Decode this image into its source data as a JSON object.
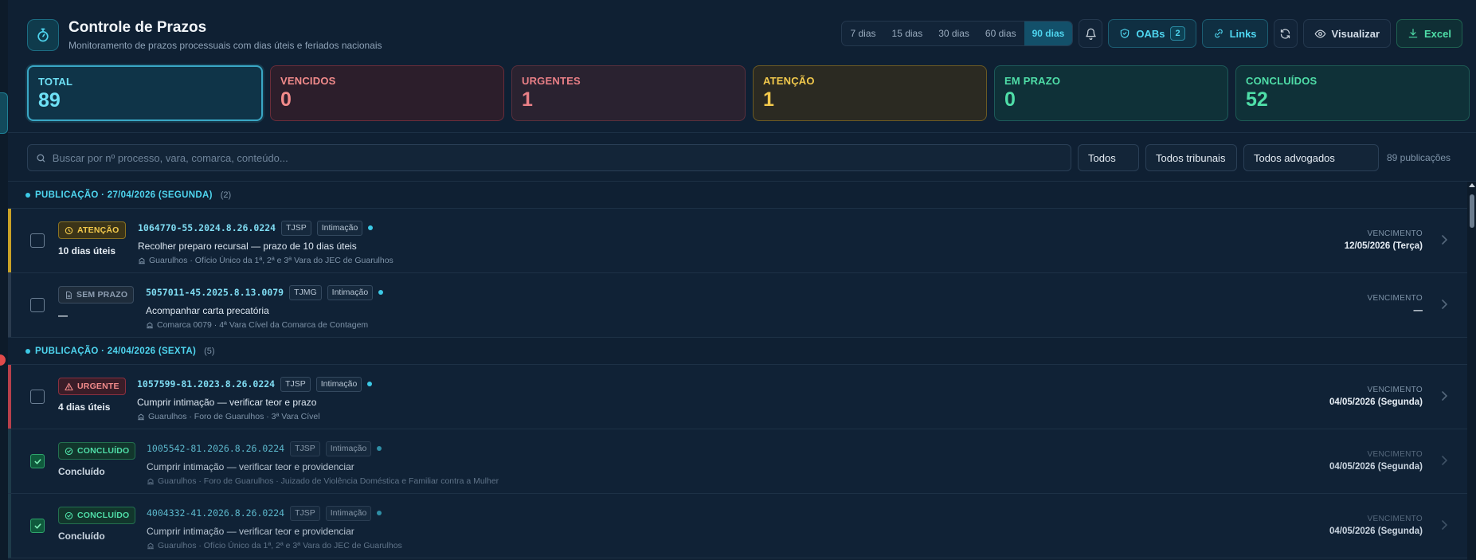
{
  "header": {
    "title": "Controle de Prazos",
    "subtitle": "Monitoramento de prazos processuais com dias úteis e feriados nacionais"
  },
  "toolbar": {
    "periods": [
      "7 dias",
      "15 dias",
      "30 dias",
      "60 dias",
      "90 dias"
    ],
    "active_period": "90 dias",
    "oabs_label": "OABs",
    "oabs_count": "2",
    "links_label": "Links",
    "visualizar_label": "Visualizar",
    "excel_label": "Excel"
  },
  "stats": [
    {
      "label": "TOTAL",
      "value": "89"
    },
    {
      "label": "VENCIDOS",
      "value": "0"
    },
    {
      "label": "URGENTES",
      "value": "1"
    },
    {
      "label": "ATENÇÃO",
      "value": "1"
    },
    {
      "label": "EM PRAZO",
      "value": "0"
    },
    {
      "label": "CONCLUÍDOS",
      "value": "52"
    }
  ],
  "filters": {
    "search_placeholder": "Buscar por nº processo, vara, comarca, conteúdo...",
    "status_select": "Todos",
    "tribunal_select": "Todos tribunais",
    "advogado_select": "Todos advogados",
    "count_text": "89 publicações"
  },
  "groups": [
    {
      "title": "PUBLICAÇÃO · 27/04/2026 (SEGUNDA)",
      "count": "(2)",
      "rows": [
        {
          "status": "ATENÇÃO",
          "days": "10 dias úteis",
          "process": "1064770-55.2024.8.26.0224",
          "tribunal": "TJSP",
          "type": "Intimação",
          "description": "Recolher preparo recursal — prazo de 10 dias úteis",
          "location": "Guarulhos · Ofício Único da 1ª, 2ª e 3ª Vara do JEC de Guarulhos",
          "venc_label": "VENCIMENTO",
          "venc_date": "12/05/2026 (Terça)"
        },
        {
          "status": "SEM PRAZO",
          "days": "—",
          "process": "5057011-45.2025.8.13.0079",
          "tribunal": "TJMG",
          "type": "Intimação",
          "description": "Acompanhar carta precatória",
          "location": "Comarca 0079 · 4ª Vara Cível da Comarca de Contagem",
          "venc_label": "VENCIMENTO",
          "venc_date": "—"
        }
      ]
    },
    {
      "title": "PUBLICAÇÃO · 24/04/2026 (SEXTA)",
      "count": "(5)",
      "rows": [
        {
          "status": "URGENTE",
          "days": "4 dias úteis",
          "process": "1057599-81.2023.8.26.0224",
          "tribunal": "TJSP",
          "type": "Intimação",
          "description": "Cumprir intimação — verificar teor e prazo",
          "location": "Guarulhos · Foro de Guarulhos · 3ª Vara Cível",
          "venc_label": "VENCIMENTO",
          "venc_date": "04/05/2026 (Segunda)"
        },
        {
          "status": "CONCLUÍDO",
          "days": "Concluído",
          "process": "1005542-81.2026.8.26.0224",
          "tribunal": "TJSP",
          "type": "Intimação",
          "description": "Cumprir intimação — verificar teor e providenciar",
          "location": "Guarulhos · Foro de Guarulhos · Juizado de Violência Doméstica e Familiar contra a Mulher",
          "venc_label": "VENCIMENTO",
          "venc_date": "04/05/2026 (Segunda)"
        },
        {
          "status": "CONCLUÍDO",
          "days": "Concluído",
          "process": "4004332-41.2026.8.26.0224",
          "tribunal": "TJSP",
          "type": "Intimação",
          "description": "Cumprir intimação — verificar teor e providenciar",
          "location": "Guarulhos · Ofício Único da 1ª, 2ª e 3ª Vara do JEC de Guarulhos",
          "venc_label": "VENCIMENTO",
          "venc_date": "04/05/2026 (Segunda)"
        }
      ]
    }
  ],
  "colors": {
    "accent": "#4fd6f0",
    "atencao": "#f2c94c",
    "urgente": "#f28b8b",
    "concluido": "#4fdea8"
  }
}
